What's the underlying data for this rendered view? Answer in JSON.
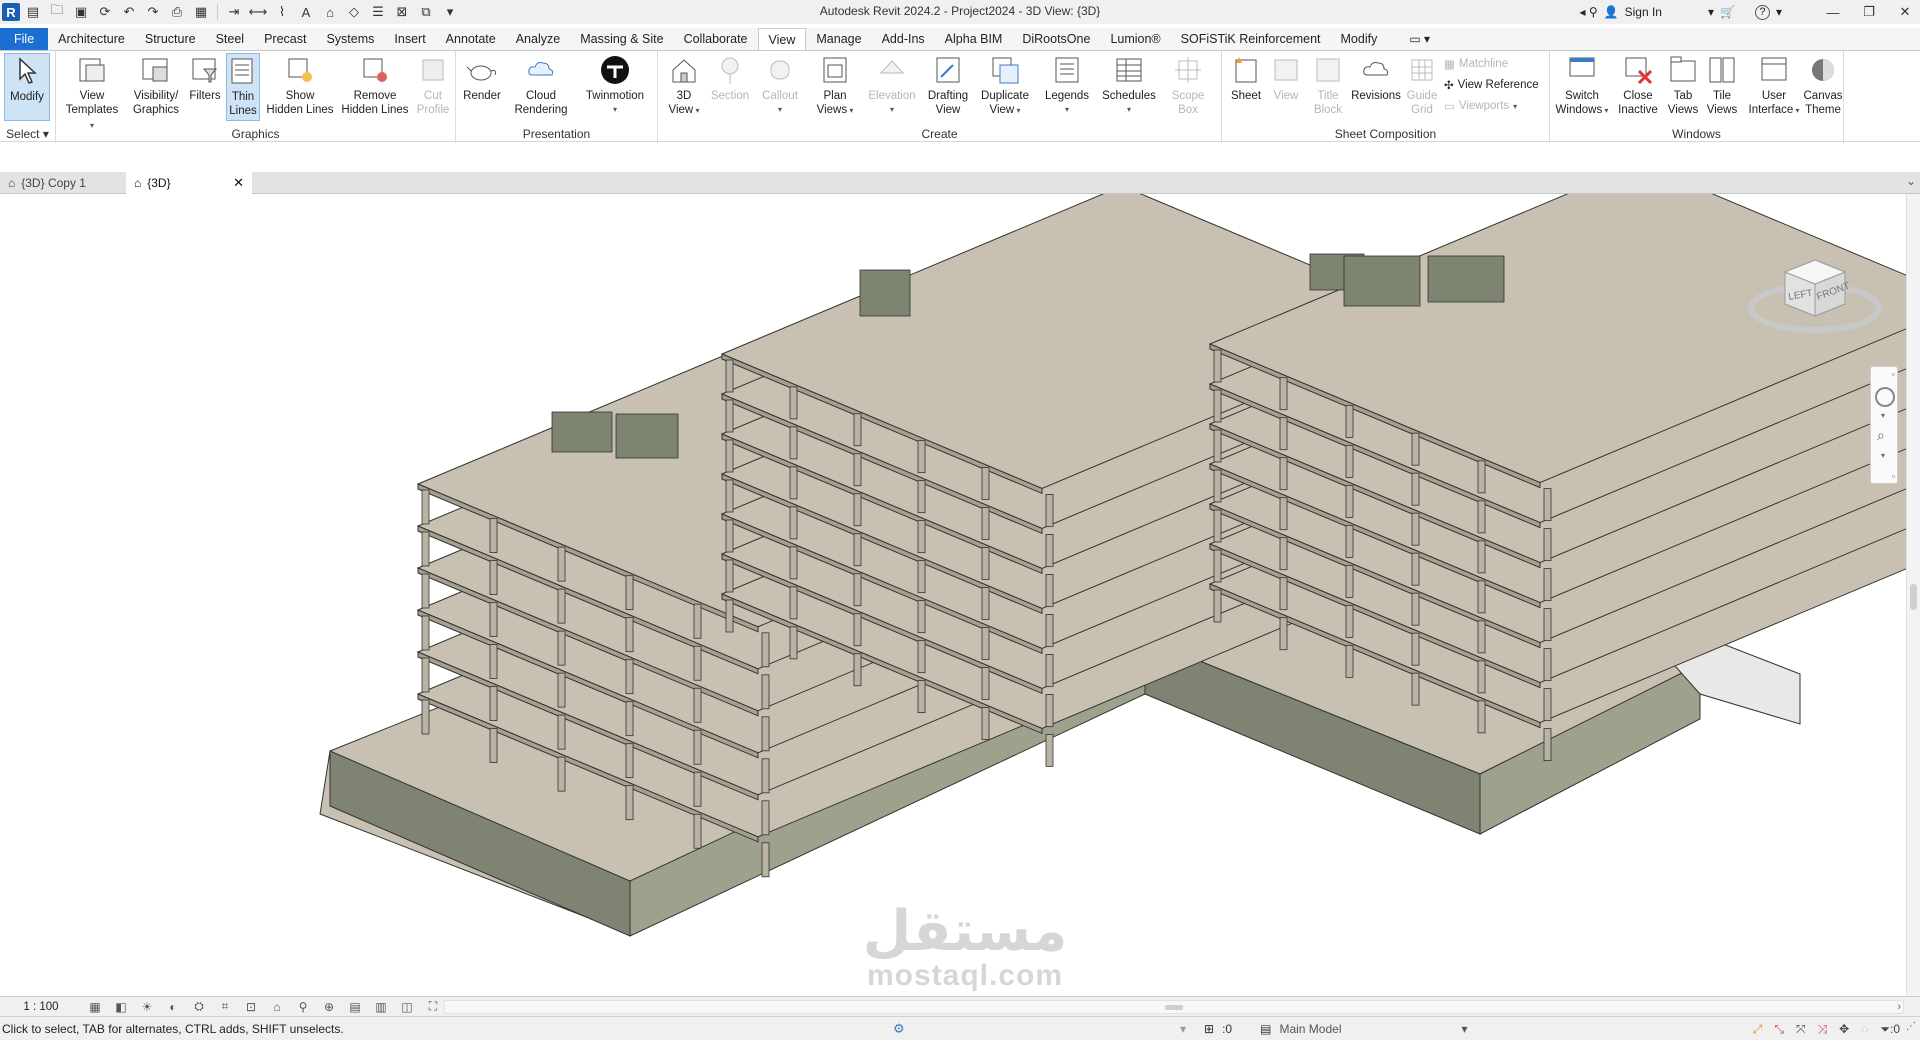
{
  "window": {
    "title": "Autodesk Revit 2024.2 - Project2024 - 3D View: {3D}",
    "sign_in": "Sign In",
    "help": "?"
  },
  "ribbon_tabs": [
    {
      "label": "File"
    },
    {
      "label": "Architecture"
    },
    {
      "label": "Structure"
    },
    {
      "label": "Steel"
    },
    {
      "label": "Precast"
    },
    {
      "label": "Systems"
    },
    {
      "label": "Insert"
    },
    {
      "label": "Annotate"
    },
    {
      "label": "Analyze"
    },
    {
      "label": "Massing & Site"
    },
    {
      "label": "Collaborate"
    },
    {
      "label": "View"
    },
    {
      "label": "Manage"
    },
    {
      "label": "Add-Ins"
    },
    {
      "label": "Alpha BIM"
    },
    {
      "label": "DiRootsOne"
    },
    {
      "label": "Lumion®"
    },
    {
      "label": "SOFiSTiK Reinforcement"
    },
    {
      "label": "Modify"
    }
  ],
  "panels": {
    "select": {
      "title": "Select",
      "modify": "Modify"
    },
    "graphics": {
      "title": "Graphics",
      "view_templates_1": "View",
      "view_templates_2": "Templates",
      "visibility_1": "Visibility/",
      "visibility_2": "Graphics",
      "filters": "Filters",
      "thin_lines_1": "Thin",
      "thin_lines_2": "Lines",
      "show_hidden_1": "Show",
      "show_hidden_2": "Hidden Lines",
      "remove_hidden_1": "Remove",
      "remove_hidden_2": "Hidden Lines",
      "cut_profile_1": "Cut",
      "cut_profile_2": "Profile"
    },
    "presentation": {
      "title": "Presentation",
      "render": "Render",
      "cloud_1": "Cloud",
      "cloud_2": "Rendering",
      "twinmotion": "Twinmotion"
    },
    "create": {
      "title": "Create",
      "view3d_1": "3D",
      "view3d_2": "View",
      "section": "Section",
      "callout": "Callout",
      "plan_1": "Plan",
      "plan_2": "Views",
      "elevation": "Elevation",
      "drafting_1": "Drafting",
      "drafting_2": "View",
      "duplicate_1": "Duplicate",
      "duplicate_2": "View",
      "legends": "Legends",
      "schedules": "Schedules",
      "scope_1": "Scope",
      "scope_2": "Box"
    },
    "sheet": {
      "title": "Sheet Composition",
      "sheet": "Sheet",
      "view": "View",
      "title_block_1": "Title",
      "title_block_2": "Block",
      "revisions": "Revisions",
      "guide_1": "Guide",
      "guide_2": "Grid",
      "matchline": "Matchline",
      "view_reference": "View  Reference",
      "viewports": "Viewports"
    },
    "windows": {
      "title": "Windows",
      "switch_1": "Switch",
      "switch_2": "Windows",
      "close_1": "Close",
      "close_2": "Inactive",
      "tab_1": "Tab",
      "tab_2": "Views",
      "tile_1": "Tile",
      "tile_2": "Views",
      "ui_1": "User",
      "ui_2": "Interface",
      "canvas_1": "Canvas",
      "canvas_2": "Theme"
    }
  },
  "view_tabs": [
    {
      "label": "{3D} Copy 1"
    },
    {
      "label": "{3D}"
    }
  ],
  "viewcube": {
    "left": "LEFT",
    "front": "FRONT"
  },
  "watermark": {
    "arabic": "مستقل",
    "latin": "mostaql.com"
  },
  "view_control": {
    "scale": "1 : 100"
  },
  "status": {
    "hint": "Click to select, TAB for alternates, CTRL adds, SHIFT unselects.",
    "worksets": ":0",
    "model": "Main Model",
    "filter_count": ":0"
  },
  "colors": {
    "accent": "#1a6fd1",
    "slab": "#c8c1b2",
    "slab_dark": "#a79f8f",
    "wall": "#9ea28c",
    "wall_dark": "#7e8471"
  }
}
